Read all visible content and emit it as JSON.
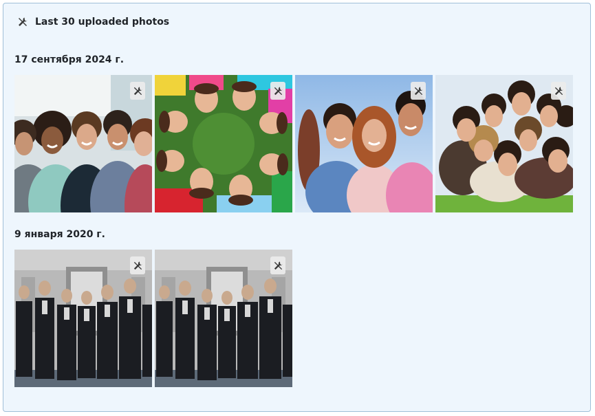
{
  "header": {
    "title": "Last 30 uploaded photos",
    "icon": "tools-icon"
  },
  "groups": [
    {
      "date": "17 сентября 2024 г.",
      "photos": [
        {
          "icon": "tools-icon"
        },
        {
          "icon": "tools-icon"
        },
        {
          "icon": "tools-icon"
        },
        {
          "icon": "tools-icon"
        }
      ]
    },
    {
      "date": "9 января 2020 г.",
      "photos": [
        {
          "icon": "tools-icon"
        },
        {
          "icon": "tools-icon"
        }
      ]
    }
  ],
  "colors": {
    "panel_bg": "#eef6fd",
    "panel_border": "#9fbfd8"
  }
}
